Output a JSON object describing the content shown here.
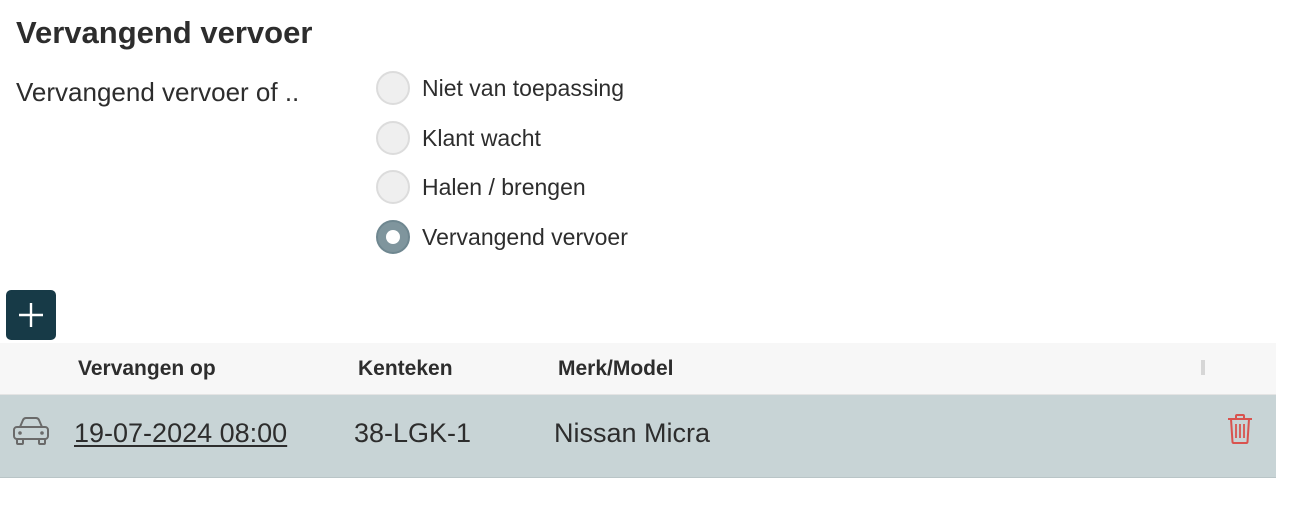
{
  "section": {
    "title": "Vervangend vervoer"
  },
  "field": {
    "label": "Vervangend vervoer of .."
  },
  "radio_options": [
    {
      "label": "Niet van toepassing",
      "checked": false
    },
    {
      "label": "Klant wacht",
      "checked": false
    },
    {
      "label": "Halen / brengen",
      "checked": false
    },
    {
      "label": "Vervangend vervoer",
      "checked": true
    }
  ],
  "add_button": {
    "icon": "plus-icon"
  },
  "table": {
    "headers": [
      "Vervangen op",
      "Kenteken",
      "Merk/Model"
    ],
    "rows": [
      {
        "icon": "car-icon",
        "date": "19-07-2024 08:00",
        "plate": "38-LGK-1",
        "model": "Nissan Micra",
        "action_icon": "trash-icon"
      }
    ]
  },
  "colors": {
    "add_button_bg": "#173a47",
    "selected_row_bg": "#c8d4d6",
    "radio_checked": "#7f959d",
    "delete_red": "#d9534f"
  }
}
